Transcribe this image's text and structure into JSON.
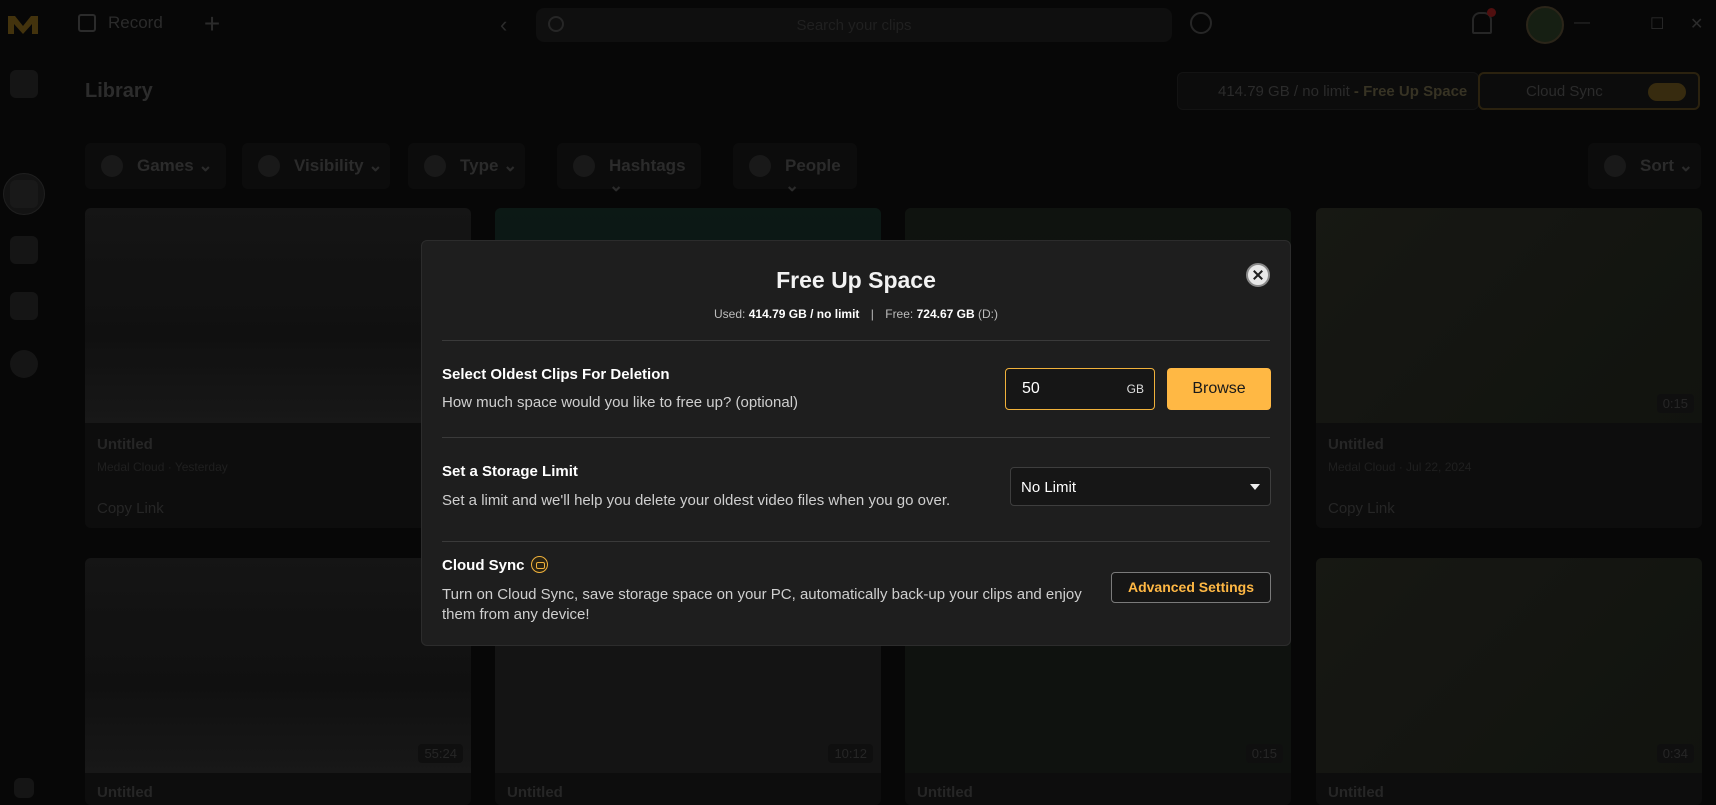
{
  "titlebar": {
    "record_label": "Record",
    "search_placeholder": "Search your clips"
  },
  "library": {
    "title": "Library",
    "storage_used": "414.79 GB / no limit",
    "storage_action": " - Free Up Space",
    "cloud_sync_label": "Cloud Sync"
  },
  "filters": [
    {
      "label": "Games"
    },
    {
      "label": "Visibility"
    },
    {
      "label": "Type"
    },
    {
      "label": "Hashtags"
    },
    {
      "label": "People"
    },
    {
      "label": "Sort"
    }
  ],
  "cards": [
    {
      "title": "Untitled",
      "meta": "Medal Cloud · Yesterday",
      "duration": "",
      "copy": "Copy Link"
    },
    {
      "title": "Untitled",
      "meta": "Medal Cloud · Jul 22, 2024",
      "duration": "0:15",
      "copy": "Copy Link"
    },
    {
      "title": "Untitled",
      "duration": "55:24"
    },
    {
      "title": "Untitled",
      "duration": "10:12"
    },
    {
      "title": "Untitled",
      "duration": "0:15"
    },
    {
      "title": "Untitled",
      "duration": "0:34"
    }
  ],
  "modal": {
    "title": "Free Up Space",
    "used_label": "Used:",
    "used_value": "414.79 GB / no limit",
    "separator": "|",
    "free_label": "Free:",
    "free_value": "724.67 GB",
    "free_drive": "(D:)",
    "section1": {
      "title": "Select Oldest Clips For Deletion",
      "desc": "How much space would you like to free up? (optional)",
      "input_value": "50",
      "unit": "GB",
      "button": "Browse"
    },
    "section2": {
      "title": "Set a Storage Limit",
      "desc": "Set a limit and we'll help you delete your oldest video files when you go over.",
      "selected": "No Limit"
    },
    "section3": {
      "title": "Cloud Sync",
      "desc": "Turn on Cloud Sync, save storage space on your PC, automatically back-up your clips and enjoy them from any device!",
      "button": "Advanced Settings"
    }
  },
  "colors": {
    "accent": "#ffb844",
    "modal_bg": "#1e1e1e"
  }
}
